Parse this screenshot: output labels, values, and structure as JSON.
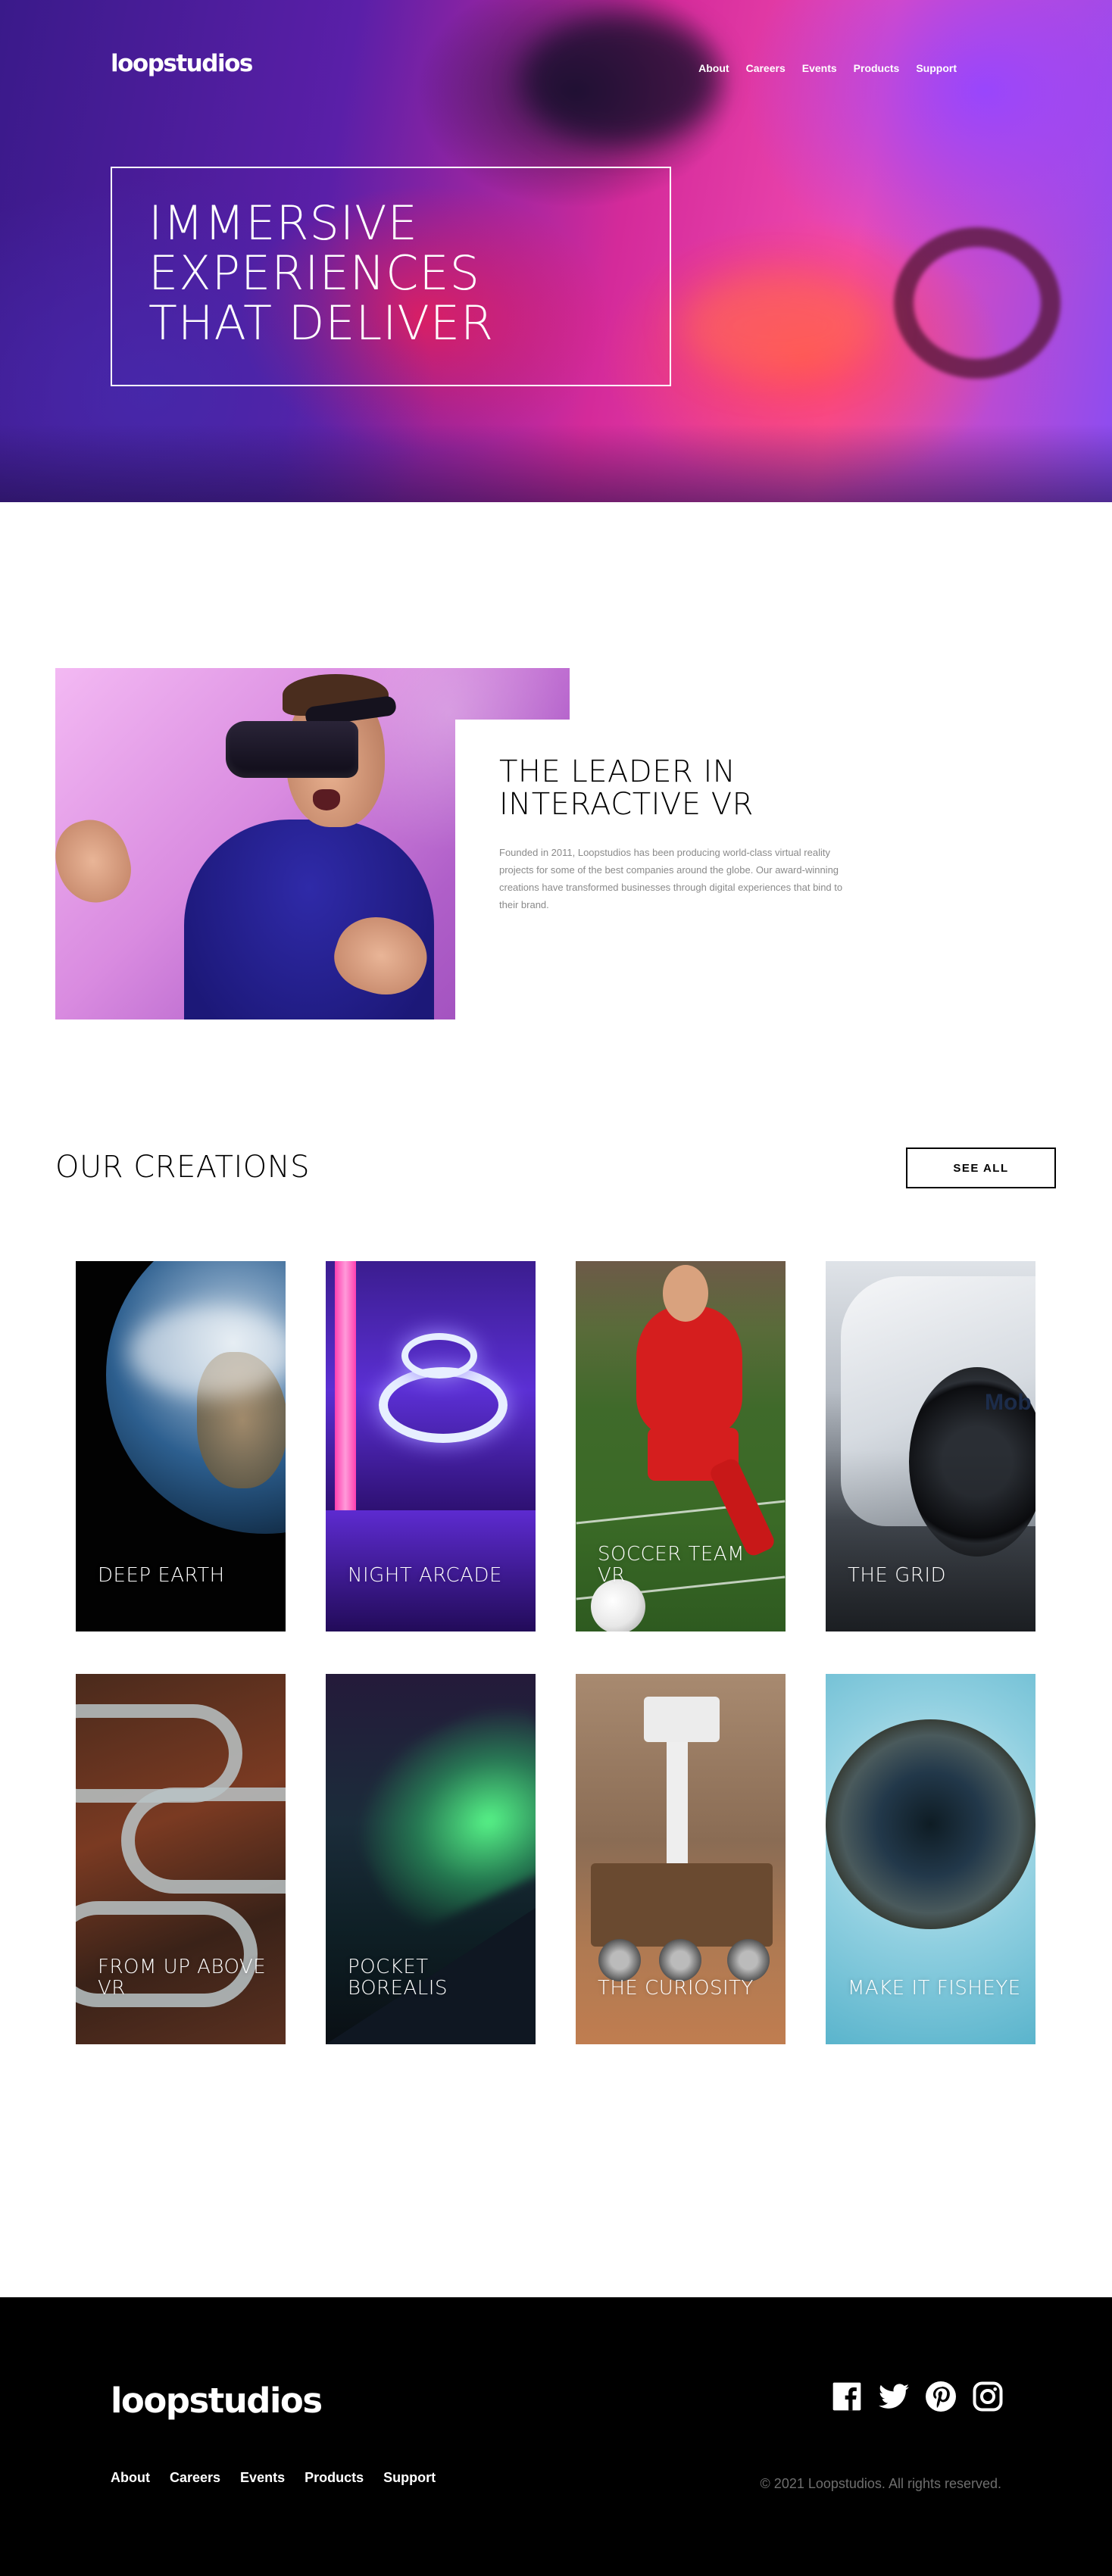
{
  "brand": {
    "name": "loopstudios"
  },
  "nav": {
    "items": [
      {
        "label": "About"
      },
      {
        "label": "Careers"
      },
      {
        "label": "Events"
      },
      {
        "label": "Products"
      },
      {
        "label": "Support"
      }
    ]
  },
  "hero": {
    "title_lines": [
      "IMMERSIVE",
      "EXPERIENCES",
      "THAT DELIVER"
    ]
  },
  "about": {
    "title_lines": [
      "THE LEADER IN",
      "INTERACTIVE VR"
    ],
    "text": "Founded in 2011, Loopstudios has been producing world-class virtual reality projects for some of the best companies around the globe. Our award-winning creations have transformed businesses through digital experiences that bind to their brand."
  },
  "creations": {
    "title": "OUR CREATIONS",
    "see_all_label": "SEE ALL",
    "cards": [
      {
        "label": "DEEP EARTH"
      },
      {
        "label": "NIGHT ARCADE"
      },
      {
        "label": "SOCCER TEAM VR"
      },
      {
        "label": "THE GRID"
      },
      {
        "label": "FROM UP ABOVE VR"
      },
      {
        "label": "POCKET BOREALIS"
      },
      {
        "label": "THE CURIOSITY"
      },
      {
        "label": "MAKE IT FISHEYE"
      }
    ]
  },
  "footer": {
    "logo": "loopstudios",
    "nav": [
      {
        "label": "About"
      },
      {
        "label": "Careers"
      },
      {
        "label": "Events"
      },
      {
        "label": "Products"
      },
      {
        "label": "Support"
      }
    ],
    "socials": [
      "facebook-icon",
      "twitter-icon",
      "pinterest-icon",
      "instagram-icon"
    ],
    "copyright": "© 2021 Loopstudios. All rights reserved."
  }
}
